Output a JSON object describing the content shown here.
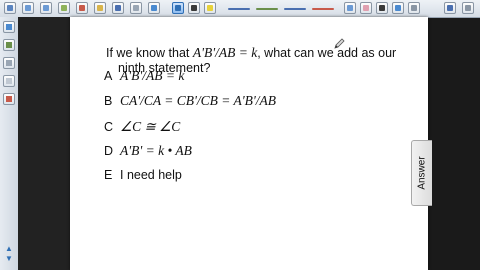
{
  "question": {
    "prefix": "If we know that ",
    "formula": "A'B'/AB = k",
    "suffix": ", what can we add as our",
    "line2": "ninth statement?"
  },
  "choices": [
    {
      "letter": "A",
      "text": "A'B'/AB = k",
      "math": true
    },
    {
      "letter": "B",
      "text": "CA'/CA = CB'/CB = A'B'/AB",
      "math": true
    },
    {
      "letter": "C",
      "text": "∠C ≅ ∠C",
      "math": true
    },
    {
      "letter": "D",
      "text": "A'B' = k • AB",
      "math": true
    },
    {
      "letter": "E",
      "text": "I need help",
      "math": false
    }
  ],
  "answer_tab": {
    "label": "Answer"
  },
  "icons": {
    "toolbar": [
      "blank-icon",
      "blank-icon",
      "blank-icon",
      "blank-icon",
      "blank-icon",
      "blank-icon",
      "blank-icon",
      "blank-icon",
      "blank-icon",
      "blank-icon",
      "blank-icon",
      "blank-icon",
      "pen-tools-icon",
      "blank-icon",
      "line-tools-icon"
    ],
    "sidebar": [
      "page-sorter-icon",
      "gallery-icon",
      "attachments-icon",
      "properties-icon"
    ]
  },
  "colors": {
    "accent": "#2f6fb5",
    "page": "#ffffff",
    "background": "#1a1a1a"
  }
}
